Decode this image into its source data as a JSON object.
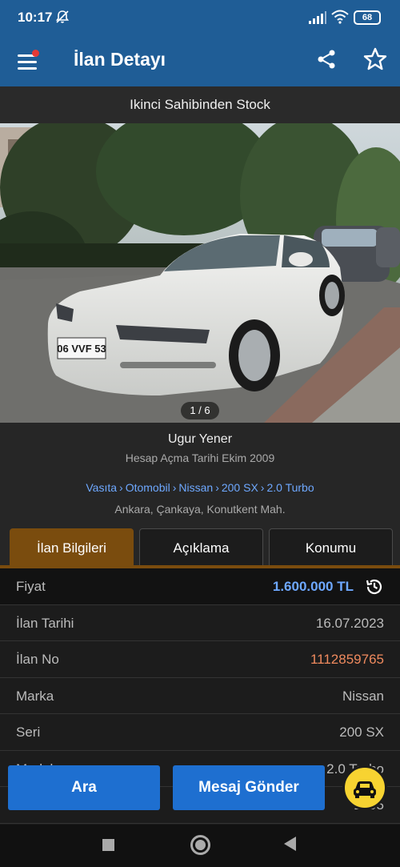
{
  "status_bar": {
    "time": "10:17",
    "battery": "68",
    "icons": [
      "mute-icon",
      "signal-icon",
      "wifi-icon",
      "battery-icon"
    ]
  },
  "app_bar": {
    "title": "İlan Detayı",
    "icons": [
      "menu-icon",
      "share-icon",
      "star-icon"
    ],
    "accent": "#1f5d96"
  },
  "listing": {
    "subtitle": "Ikinci Sahibinden Stock",
    "photo_counter": "1 / 6",
    "plate": "06 VVF 53"
  },
  "seller": {
    "name": "Ugur Yener",
    "since": "Hesap Açma Tarihi  Ekim 2009"
  },
  "breadcrumb": [
    "Vasıta",
    "Otomobil",
    "Nissan",
    "200 SX",
    "2.0 Turbo"
  ],
  "breadcrumb_sep": "›",
  "location": "Ankara, Çankaya, Konutkent Mah.",
  "tabs": [
    "İlan Bilgileri",
    "Açıklama",
    "Konumu"
  ],
  "rows": [
    {
      "label": "Fiyat",
      "value": "1.600.000 TL"
    },
    {
      "label": "İlan Tarihi",
      "value": "16.07.2023"
    },
    {
      "label": "İlan No",
      "value": "1112859765"
    },
    {
      "label": "Marka",
      "value": "Nissan"
    },
    {
      "label": "Seri",
      "value": "200 SX"
    },
    {
      "label": "Model",
      "value": "2.0 Turbo"
    },
    {
      "label": "Yıl",
      "value": "1995"
    }
  ],
  "actions": {
    "call": "Ara",
    "message": "Mesaj Gönder"
  },
  "colors": {
    "price": "#6ea8ff",
    "listing_no": "#ef8a5e",
    "active_tab": "#7a4c0e",
    "button": "#1e6fd0",
    "fab": "#f7d331"
  }
}
